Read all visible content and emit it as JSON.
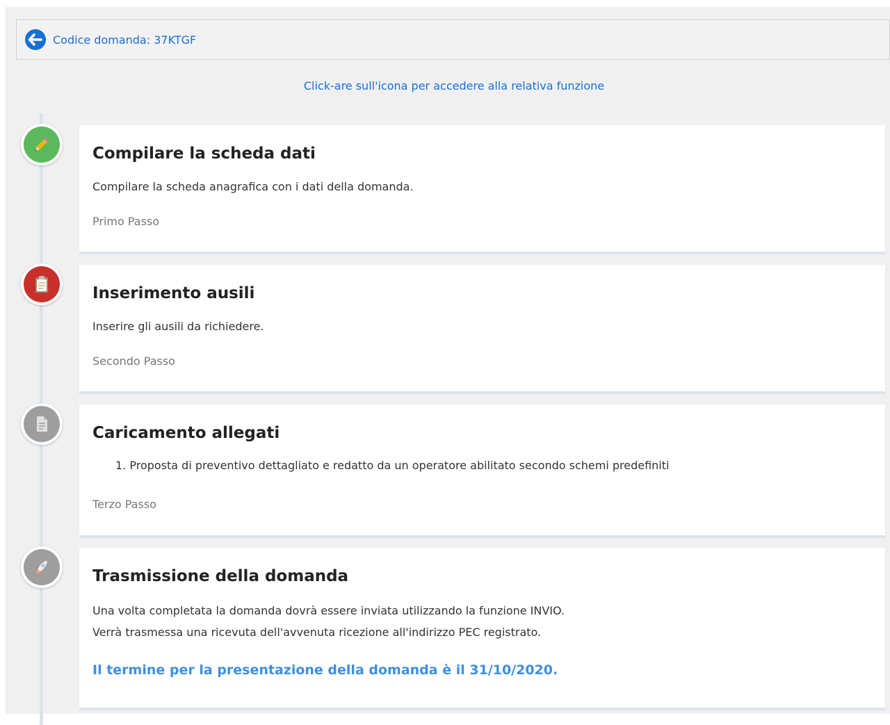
{
  "header": {
    "back_icon": "arrow-left-circle-icon",
    "application_code": "Codice domanda: 37KTGF"
  },
  "hint": "Click-are sull'icona per accedere alla relativa funzione",
  "colors": {
    "accent_blue": "#1a6fd4",
    "step1_green": "#5cb85c",
    "step2_red": "#c9302c",
    "step3_gray": "#9e9e9e",
    "step4_gray": "#9e9e9e",
    "deadline_blue": "#3d8fdf"
  },
  "steps": [
    {
      "icon": "pencil-icon",
      "title": "Compilare la scheda dati",
      "description": "Compilare la scheda anagrafica con i dati della domanda.",
      "footer": "Primo Passo"
    },
    {
      "icon": "clipboard-icon",
      "title": "Inserimento ausili",
      "description": "Inserire gli ausili da richiedere.",
      "footer": "Secondo Passo"
    },
    {
      "icon": "document-icon",
      "title": "Caricamento allegati",
      "list": [
        "1. Proposta di preventivo dettagliato e redatto da un operatore abilitato secondo schemi predefiniti"
      ],
      "footer": "Terzo Passo"
    },
    {
      "icon": "rocket-icon",
      "title": "Trasmissione della domanda",
      "description_lines": [
        "Una volta completata la domanda dovrà essere inviata utilizzando la funzione INVIO.",
        "Verrà trasmessa una ricevuta dell'avvenuta ricezione all'indirizzo PEC registrato."
      ],
      "deadline": "Il termine per la presentazione della domanda è il 31/10/2020."
    }
  ]
}
